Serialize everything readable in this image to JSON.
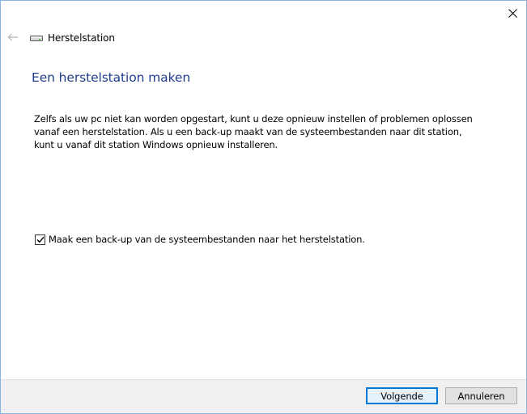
{
  "window": {
    "app_title": "Herstelstation"
  },
  "icons": {
    "back": "arrow-left-icon",
    "drive": "drive-icon",
    "close": "close-icon",
    "check": "checkmark-icon"
  },
  "content": {
    "heading": "Een herstelstation maken",
    "description_lines": [
      "Zelfs als uw pc niet kan worden opgestart, kunt u deze opnieuw instellen of problemen oplossen",
      "vanaf een herstelstation. Als u een back-up maakt van de systeembestanden naar dit station,",
      "kunt u vanaf dit station Windows opnieuw installeren."
    ],
    "checkbox": {
      "label": "Maak een back-up van de systeembestanden naar het herstelstation.",
      "checked": true
    }
  },
  "footer": {
    "next_label": "Volgende",
    "cancel_label": "Annuleren"
  },
  "colors": {
    "heading": "#1f3d8c",
    "accent": "#0078d7",
    "footer_bg": "#f0f0f0"
  }
}
